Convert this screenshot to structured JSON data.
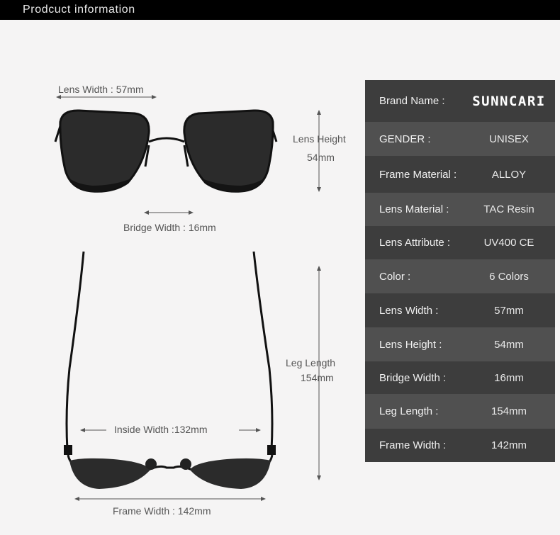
{
  "header": {
    "title": "Prodcuct information"
  },
  "dimensions": {
    "lens_width": "Lens Width : 57mm",
    "lens_height_label": "Lens Height",
    "lens_height_value": "54mm",
    "bridge_width": "Bridge Width : 16mm",
    "leg_length_label": "Leg Length",
    "leg_length_value": "154mm",
    "inside_width": "Inside  Width :132mm",
    "frame_width": "Frame Width : 142mm"
  },
  "specs": [
    {
      "key": "Brand Name :",
      "value": "SUNNCARI"
    },
    {
      "key": "GENDER :",
      "value": "UNISEX"
    },
    {
      "key": "Frame Material :",
      "value": "ALLOY"
    },
    {
      "key": "Lens Material :",
      "value": "TAC Resin"
    },
    {
      "key": "Lens Attribute :",
      "value": "UV400 CE"
    },
    {
      "key": "Color :",
      "value": "6 Colors"
    },
    {
      "key": "Lens Width :",
      "value": "57mm"
    },
    {
      "key": "Lens Height :",
      "value": "54mm"
    },
    {
      "key": "Bridge Width :",
      "value": "16mm"
    },
    {
      "key": "Leg Length :",
      "value": "154mm"
    },
    {
      "key": "Frame Width :",
      "value": "142mm"
    }
  ],
  "colors": {
    "table_dark": "#3d3d3d",
    "table_light": "#505050",
    "frame": "#111111",
    "lens": "#2a2a2a"
  }
}
